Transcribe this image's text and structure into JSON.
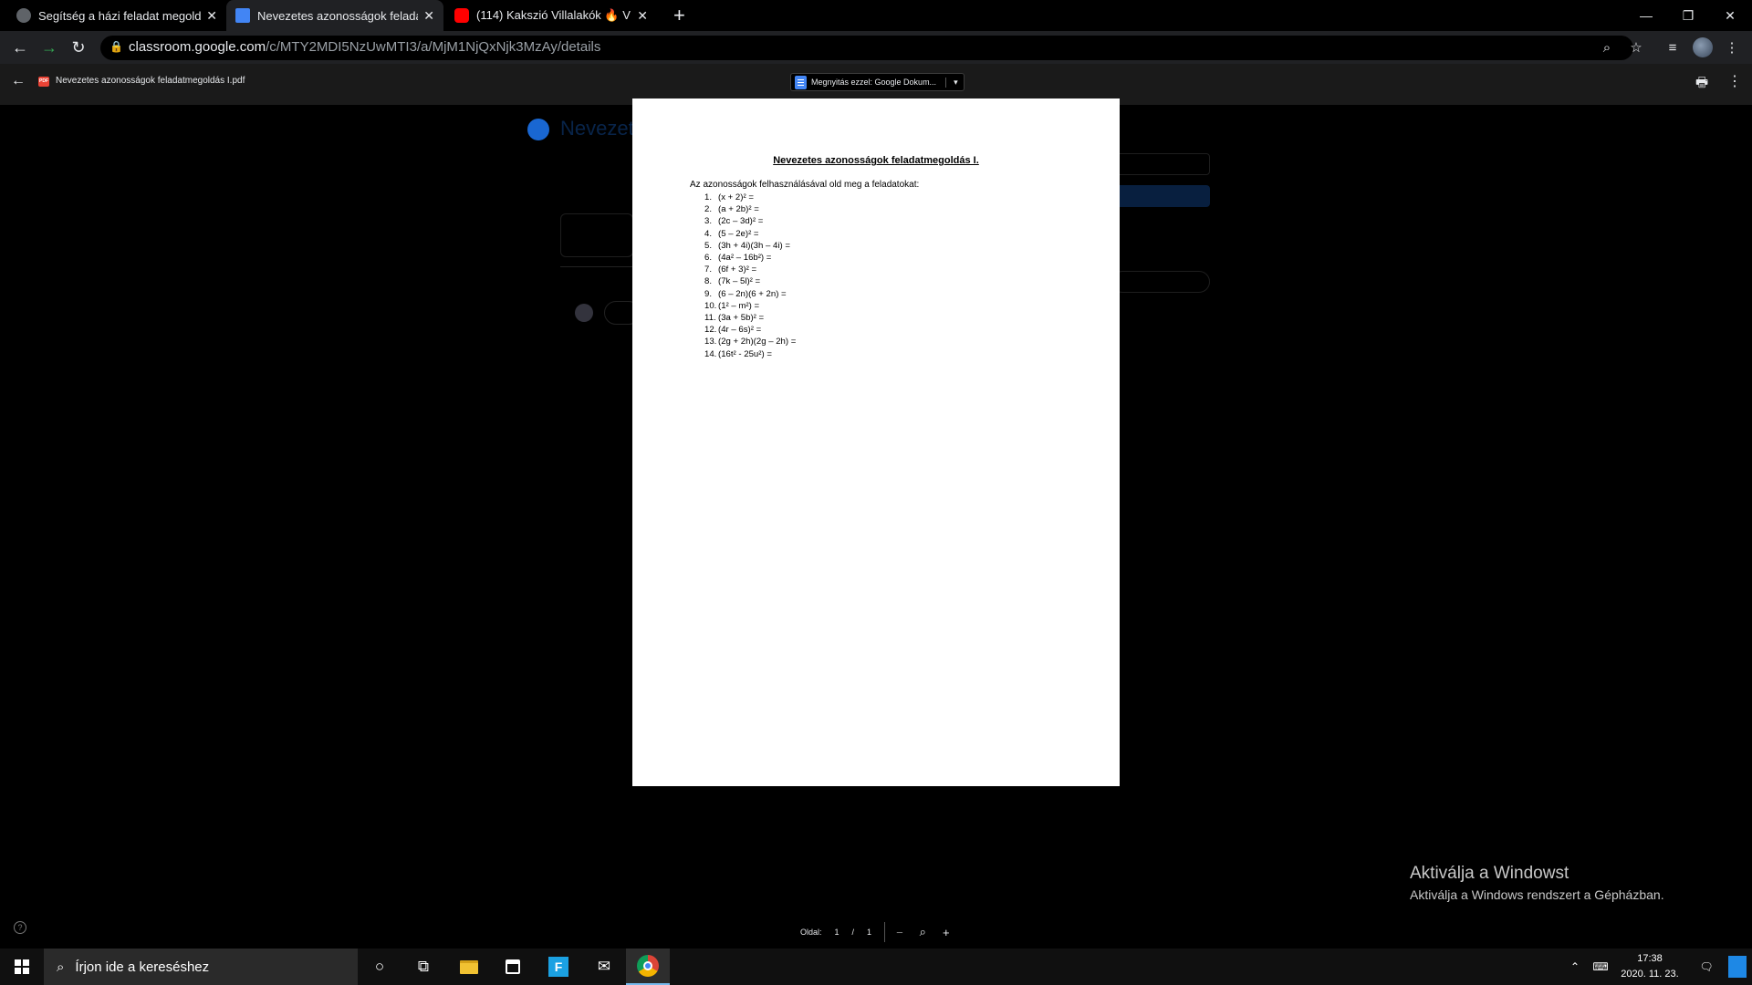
{
  "tabs": [
    {
      "title": "Segítség a házi feladat megoldás",
      "active": false
    },
    {
      "title": "Nevezetes azonosságok feladatm",
      "active": true
    },
    {
      "title": "(114) Kakszió Villalakók 🔥 V",
      "active": false
    }
  ],
  "address": {
    "domain": "classroom.google.com",
    "path": "/c/MTY2MDI5NzUwMTI3/a/MjM1NjQxNjk3MzAy/details"
  },
  "viewer": {
    "filename": "Nevezetes azonosságok feladatmegoldás I.pdf",
    "open_with": "Megnyitás ezzel: Google Dokum...",
    "pdf_badge": "PDF"
  },
  "background_page": {
    "title": "Nevezetes"
  },
  "document": {
    "title": "Nevezetes azonosságok feladatmegoldás I.",
    "intro": "Az azonosságok felhasználásával old meg a feladatokat:",
    "items": [
      {
        "num": "1.",
        "text": "(x + 2)² ="
      },
      {
        "num": "2.",
        "text": "(a + 2b)² ="
      },
      {
        "num": "3.",
        "text": "(2c – 3d)² ="
      },
      {
        "num": "4.",
        "text": "(5 – 2e)² ="
      },
      {
        "num": "5.",
        "text": "(3h + 4i)(3h – 4i) ="
      },
      {
        "num": "6.",
        "text": "(4a² – 16b²) ="
      },
      {
        "num": "7.",
        "text": "(6f + 3)² ="
      },
      {
        "num": "8.",
        "text": "(7k – 5l)² ="
      },
      {
        "num": "9.",
        "text": "(6 – 2n)(6 + 2n) ="
      },
      {
        "num": "10.",
        "text": "(1² – m²) ="
      },
      {
        "num": "11.",
        "text": "(3a + 5b)² ="
      },
      {
        "num": "12.",
        "text": "(4r – 6s)² ="
      },
      {
        "num": "13.",
        "text": "(2g + 2h)(2g – 2h) ="
      },
      {
        "num": "14.",
        "text": "(16t² - 25u²) ="
      }
    ]
  },
  "pager": {
    "label": "Oldal:",
    "current": "1",
    "separator": "/",
    "total": "1"
  },
  "watermark": {
    "line1": "Aktiválja a Windowst",
    "line2": "Aktiválja a Windows rendszert a Gépházban."
  },
  "taskbar": {
    "search_placeholder": "Írjon ide a kereséshez",
    "time": "17:38",
    "date": "2020. 11. 23."
  },
  "icons": [
    "back-icon",
    "forward-icon",
    "reload-icon",
    "lock-icon",
    "zoom-icon",
    "star-icon",
    "media-icon",
    "more-icon",
    "print-icon",
    "help-icon",
    "search-icon",
    "cortana-icon",
    "task-view-icon",
    "file-explorer-icon",
    "store-icon",
    "mail-icon",
    "chrome-icon"
  ],
  "colors": {
    "accent_blue": "#1967d2",
    "pdf_red": "#ea4335",
    "docs_blue": "#4285f4"
  }
}
